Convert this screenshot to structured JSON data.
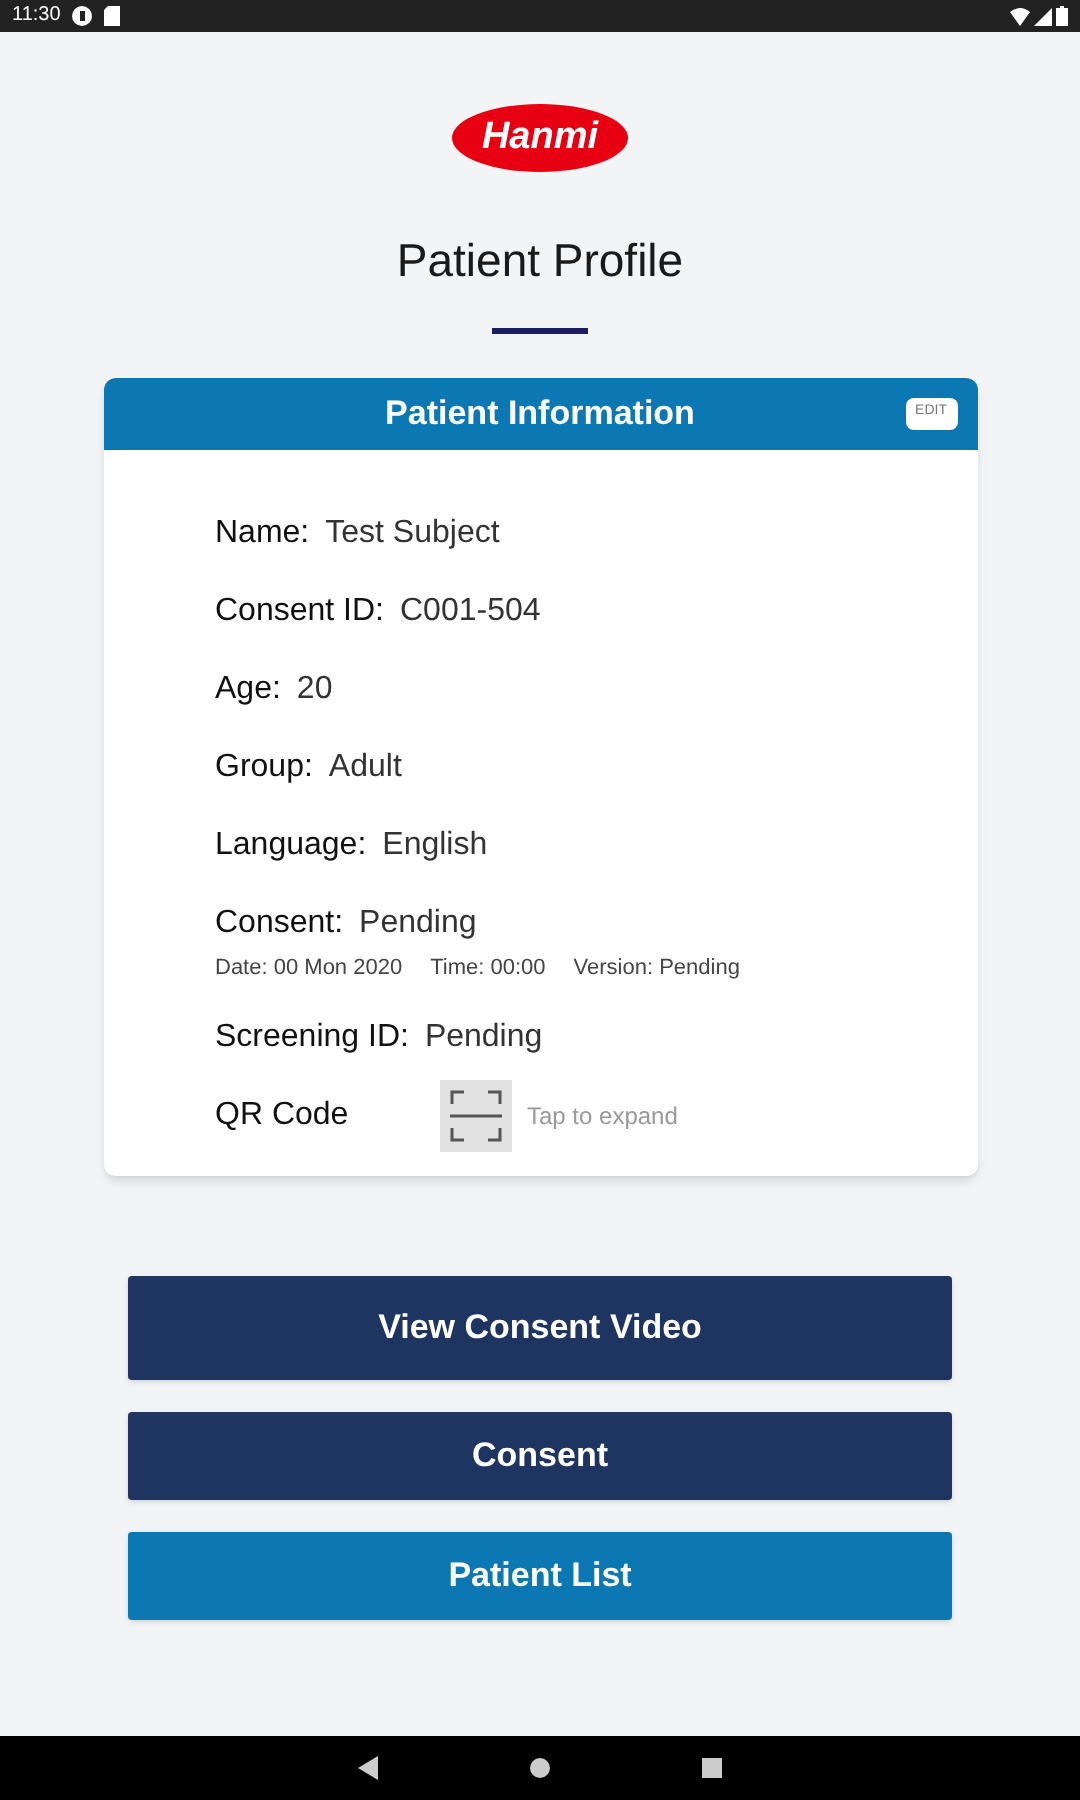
{
  "status_bar": {
    "time": "11:30"
  },
  "logo": {
    "text": "Hanmi"
  },
  "title": "Patient Profile",
  "card": {
    "title": "Patient Information",
    "edit_button": "EDIT",
    "fields": [
      {
        "label": "Name:",
        "value": "Test Subject"
      },
      {
        "label": "Consent ID:",
        "value": "C001-504"
      },
      {
        "label": "Age:",
        "value": "20"
      },
      {
        "label": "Group:",
        "value": "Adult"
      },
      {
        "label": "Language:",
        "value": "English"
      },
      {
        "label": "Consent:",
        "value": "Pending",
        "details": [
          {
            "label": "Date:",
            "value": "00 Mon 2020"
          },
          {
            "label": "Time:",
            "value": "00:00"
          },
          {
            "label": "Version:",
            "value": "Pending"
          }
        ]
      },
      {
        "label": "Screening ID:",
        "value": "Pending"
      }
    ],
    "qr": {
      "label": "QR Code",
      "hint": "Tap to expand"
    }
  },
  "buttons": [
    {
      "label": "View Consent Video",
      "kind": "primary"
    },
    {
      "label": "Consent",
      "kind": "primary"
    },
    {
      "label": "Patient List",
      "kind": "secondary"
    }
  ]
}
